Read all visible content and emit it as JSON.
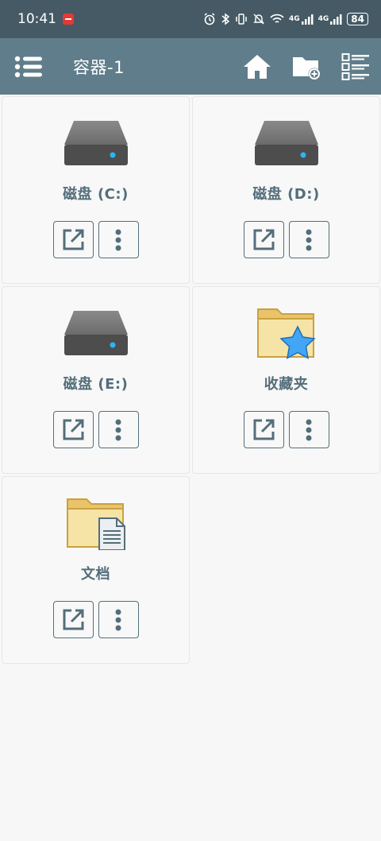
{
  "status_bar": {
    "time": "10:41",
    "net1": "4G",
    "net2": "4G",
    "battery": "84"
  },
  "app_bar": {
    "title": "容器-1",
    "icons": [
      "menu-icon",
      "home-icon",
      "new-folder-icon",
      "list-view-icon"
    ]
  },
  "items": [
    {
      "label": "磁盘 (C:)",
      "icon": "hard-drive-icon"
    },
    {
      "label": "磁盘 (D:)",
      "icon": "hard-drive-icon"
    },
    {
      "label": "磁盘 (E:)",
      "icon": "hard-drive-icon"
    },
    {
      "label": "收藏夹",
      "icon": "favorites-folder-icon"
    },
    {
      "label": "文档",
      "icon": "documents-folder-icon"
    }
  ],
  "colors": {
    "status_bar": "#455a64",
    "app_bar": "#607d8b",
    "text": "#546e7a",
    "background": "#f7f7f7"
  }
}
